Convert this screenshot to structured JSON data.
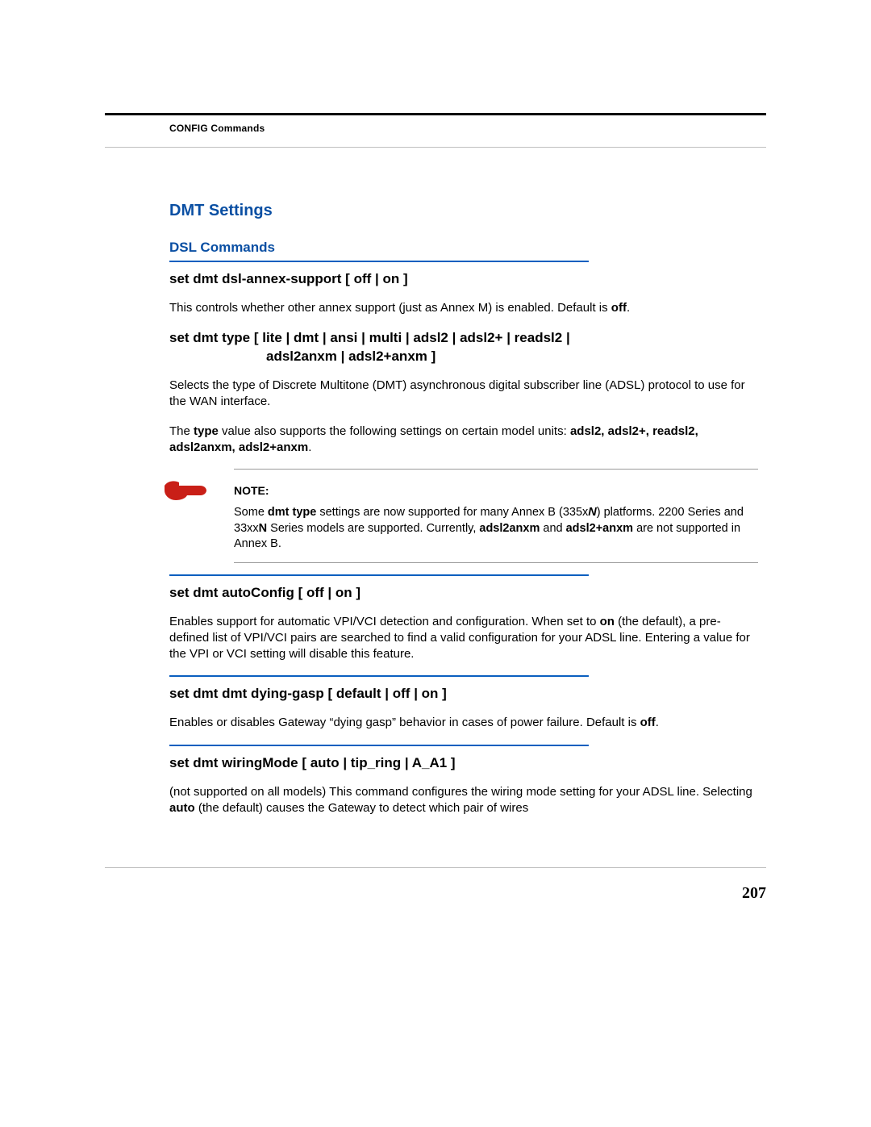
{
  "header": {
    "running_head": "CONFIG Commands"
  },
  "section_title": "DMT Settings",
  "subsection_title": "DSL Commands",
  "cmd1": {
    "title": "set dmt dsl-annex-support [ off | on ]",
    "desc_pre": "This controls whether other annex support (just as Annex M) is enabled. Default is ",
    "desc_bold": "off",
    "desc_post": "."
  },
  "cmd2": {
    "title_line1": "set dmt type [ lite | dmt | ansi | multi | adsl2 | adsl2+ | readsl2 |",
    "title_line2": "adsl2anxm | adsl2+anxm ]",
    "p1": "Selects the type of Discrete Multitone (DMT) asynchronous digital subscriber line (ADSL) protocol to use for the WAN interface.",
    "p2_pre": "The ",
    "p2_bold1": "type",
    "p2_mid": " value also supports the following settings on certain model units: ",
    "p2_list": "adsl2, adsl2+, readsl2, adsl2anxm, adsl2+anxm",
    "p2_post": "."
  },
  "note": {
    "label": "NOTE:",
    "t1_a": "Some ",
    "t1_b": "dmt type",
    "t1_c": " settings are now supported for many Annex B (335x",
    "t1_d": "N",
    "t1_e": ") platforms. 2200 Series and 33xx",
    "t1_f": "N",
    "t1_g": " Series models are supported. Currently, ",
    "t1_h": "adsl2anxm",
    "t1_i": " and ",
    "t1_j": "adsl2+anxm",
    "t1_k": " are not supported in Annex B."
  },
  "cmd3": {
    "title": "set dmt autoConfig [ off | on ]",
    "desc_a": "Enables support for automatic VPI/VCI detection and configuration. When set to ",
    "desc_b": "on",
    "desc_c": " (the default), a pre-defined list of VPI/VCI pairs are searched to find a valid configuration for your ADSL line. Entering a value for the VPI or VCI setting will disable this feature."
  },
  "cmd4": {
    "title": "set dmt dmt dying-gasp [ default | off | on ]",
    "desc_a": "Enables or disables Gateway “dying gasp” behavior in cases of power failure. Default is ",
    "desc_b": "off",
    "desc_c": "."
  },
  "cmd5": {
    "title": "set dmt wiringMode [ auto | tip_ring | A_A1 ]",
    "desc_a": "(not supported on all models) This command configures the wiring mode setting for your ADSL line. Selecting ",
    "desc_b": "auto",
    "desc_c": " (the default) causes the Gateway to detect which pair of wires"
  },
  "page_number": "207"
}
